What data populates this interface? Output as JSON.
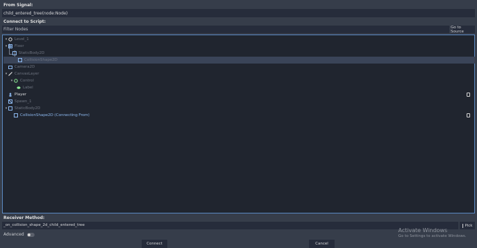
{
  "from_signal": {
    "label": "From Signal:",
    "value": "child_entered_tree(node:Node)"
  },
  "connect_to_script": {
    "label": "Connect to Script:"
  },
  "filter": {
    "placeholder": "Filter Nodes",
    "goto_source_label": "Go to Source"
  },
  "tree": {
    "nodes": [
      {
        "label": "Level_1",
        "icon": "circle-node-icon",
        "state": "dim",
        "expanded": true
      },
      {
        "label": "Floor",
        "icon": "tilemap-icon",
        "state": "dim",
        "expanded": true
      },
      {
        "label": "StaticBody2D",
        "icon": "staticbody-icon",
        "state": "dim"
      },
      {
        "label": "CollisionShape2D",
        "icon": "collision-shape-icon",
        "state": "dim",
        "selected": true
      },
      {
        "label": "Camera2D",
        "icon": "camera-icon",
        "state": "dim"
      },
      {
        "label": "CanvasLayer",
        "icon": "canvaslayer-icon",
        "state": "dim",
        "expanded": true
      },
      {
        "label": "Control",
        "icon": "control-icon",
        "state": "dim",
        "expanded": true
      },
      {
        "label": "Label",
        "icon": "label-icon",
        "state": "dim"
      },
      {
        "label": "Player",
        "icon": "player-icon",
        "state": "bright",
        "has_script": true
      },
      {
        "label": "Spawn_1",
        "icon": "spawn-icon",
        "state": "dim"
      },
      {
        "label": "StaticBody2D",
        "icon": "staticbody-icon",
        "state": "dim",
        "expanded": true
      },
      {
        "label": "CollisionShape2D (Connecting From)",
        "icon": "collision-shape-icon",
        "state": "blue",
        "has_script": true
      }
    ]
  },
  "receiver": {
    "label": "Receiver Method:",
    "value": "_on_collision_shape_2d_child_entered_tree",
    "pick_label": "Pick"
  },
  "advanced": {
    "label": "Advanced",
    "enabled": false
  },
  "buttons": {
    "connect": "Connect",
    "cancel": "Cancel"
  },
  "watermark": {
    "title": "Activate Windows",
    "subtitle": "Go to Settings to activate Windows."
  },
  "colors": {
    "accent": "#5b8ac4",
    "connecting_from": "#8db9f0",
    "panel_bg": "#20252f",
    "dialog_bg": "#363d4a"
  }
}
